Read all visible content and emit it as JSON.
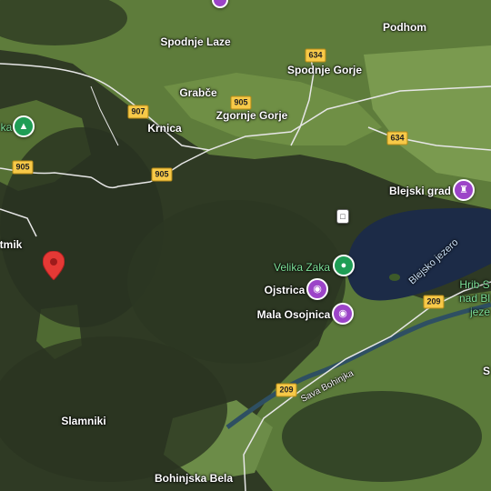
{
  "map": {
    "type": "satellite",
    "colors": {
      "forest": "#2f3a24",
      "meadow": "#5e7c3b",
      "lake": "#1c2b47",
      "road": "#ffffff",
      "shield": "#f7c948",
      "pin": "#e53935",
      "poi_purple": "#9c44c8",
      "poi_green": "#1f9d55"
    },
    "places": [
      {
        "label": "Spodnje Laze"
      },
      {
        "label": "Podhom"
      },
      {
        "label": "Spodnje Gorje"
      },
      {
        "label": "Grabče"
      },
      {
        "label": "Zgornje Gorje"
      },
      {
        "label": "Krnica"
      },
      {
        "label": "Blejski grad"
      },
      {
        "label": "Velika Zaka"
      },
      {
        "label": "Ojstrica"
      },
      {
        "label": "Mala Osojnica"
      },
      {
        "label": "Slamniki"
      },
      {
        "label": "Bohinjska Bela"
      },
      {
        "label": "tmik"
      },
      {
        "label": "Hrib S"
      },
      {
        "label": "nad Bl"
      },
      {
        "label": "jeze"
      },
      {
        "label": "Blejsko jezero"
      },
      {
        "label": "Sava Bohinjka"
      },
      {
        "label": "ka"
      },
      {
        "label": "S"
      }
    ],
    "road_shields": [
      {
        "label": "634"
      },
      {
        "label": "907"
      },
      {
        "label": "905"
      },
      {
        "label": "905"
      },
      {
        "label": "905"
      },
      {
        "label": "634"
      },
      {
        "label": "209"
      },
      {
        "label": "209"
      }
    ],
    "poi_icons": [
      {
        "icon": "castle-icon"
      },
      {
        "icon": "park-icon"
      },
      {
        "icon": "camera-icon"
      },
      {
        "icon": "camera-icon"
      },
      {
        "icon": "park-icon"
      },
      {
        "icon": "transit-icon"
      }
    ]
  }
}
